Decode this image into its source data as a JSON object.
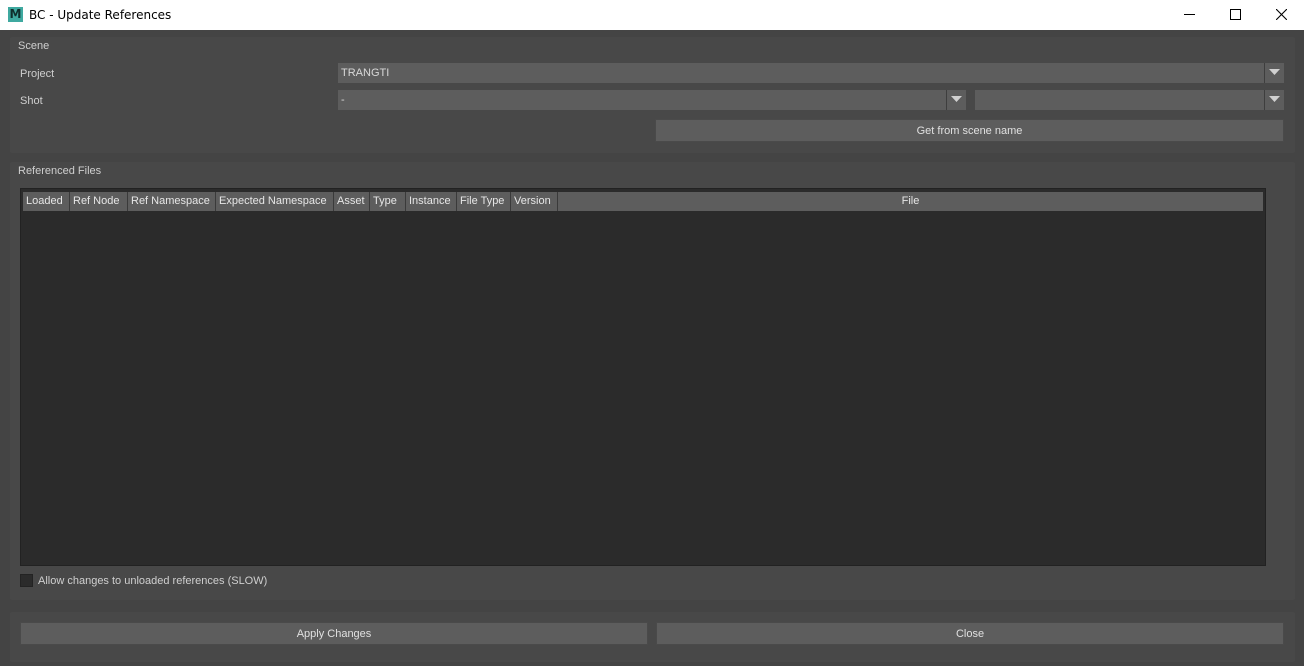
{
  "window": {
    "title": "BC - Update References",
    "app_icon_letter": "M"
  },
  "scene": {
    "group_label": "Scene",
    "project_label": "Project",
    "project_value": "TRANGTI",
    "shot_label": "Shot",
    "shot_value": "-",
    "shot_value_2": "",
    "get_from_scene_label": "Get from scene name"
  },
  "references": {
    "group_label": "Referenced Files",
    "columns": [
      "Loaded",
      "Ref Node",
      "Ref Namespace",
      "Expected Namespace",
      "Asset",
      "Type",
      "Instance",
      "File Type",
      "Version",
      "File"
    ],
    "rows": [],
    "allow_unloaded_label": "Allow changes to unloaded references (SLOW)",
    "allow_unloaded_checked": false
  },
  "actions": {
    "apply_label": "Apply Changes",
    "close_label": "Close"
  },
  "colors": {
    "background": "#444444",
    "group": "#484848",
    "control": "#5d5d5d",
    "table_bg": "#2b2b2b",
    "app_icon": "#3fa9a0"
  }
}
